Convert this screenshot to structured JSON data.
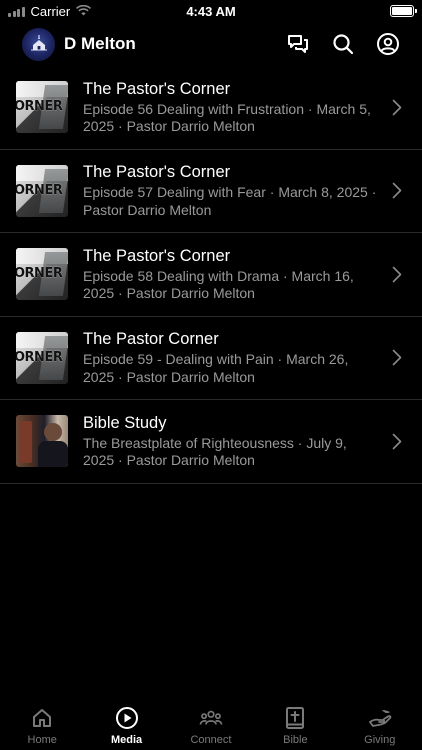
{
  "status_bar": {
    "carrier": "Carrier",
    "time": "4:43 AM"
  },
  "header": {
    "title": "D Melton"
  },
  "media_list": [
    {
      "title": "The Pastor's Corner",
      "subtitle": "Episode 56 Dealing with Frustration · March 5, 2025 · Pastor Darrio Melton",
      "thumb": "pastors-corner",
      "thumb_word": "ORNER"
    },
    {
      "title": "The Pastor's Corner",
      "subtitle": "Episode 57 Dealing with Fear · March 8, 2025 · Pastor Darrio Melton",
      "thumb": "pastors-corner",
      "thumb_word": "ORNER"
    },
    {
      "title": "The Pastor's Corner",
      "subtitle": "Episode 58 Dealing with Drama · March 16, 2025 · Pastor Darrio Melton",
      "thumb": "pastors-corner",
      "thumb_word": "ORNER"
    },
    {
      "title": "The Pastor Corner",
      "subtitle": "Episode 59 - Dealing with Pain · March 26, 2025 · Pastor Darrio Melton",
      "thumb": "pastors-corner",
      "thumb_word": "ORNER"
    },
    {
      "title": "Bible Study",
      "subtitle": "The Breastplate of Righteousness · July 9, 2025 · Pastor Darrio Melton",
      "thumb": "bible-study"
    }
  ],
  "tabs": [
    {
      "label": "Home",
      "icon": "home-icon",
      "active": false
    },
    {
      "label": "Media",
      "icon": "play-circle-icon",
      "active": true
    },
    {
      "label": "Connect",
      "icon": "people-icon",
      "active": false
    },
    {
      "label": "Bible",
      "icon": "bible-icon",
      "active": false
    },
    {
      "label": "Giving",
      "icon": "giving-hand-icon",
      "active": false
    }
  ],
  "colors": {
    "background": "#000000",
    "text_primary": "#ffffff",
    "text_secondary": "#9a9a9a",
    "divider": "#2a2a2a",
    "tab_inactive": "#7a7a7a"
  }
}
